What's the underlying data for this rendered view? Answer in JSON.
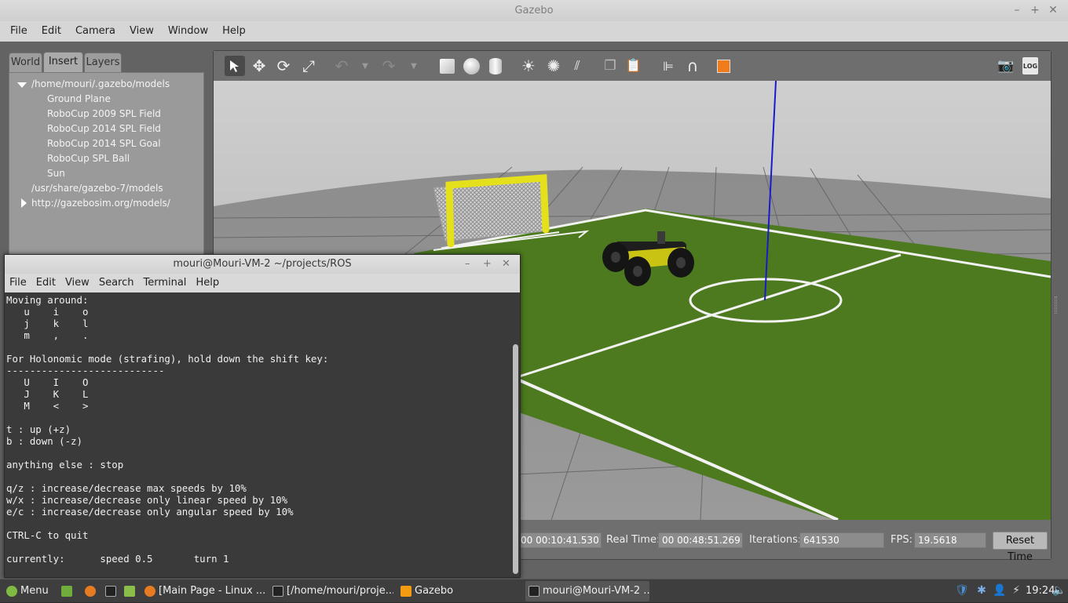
{
  "window": {
    "title": "Gazebo"
  },
  "menu": [
    "File",
    "Edit",
    "Camera",
    "View",
    "Window",
    "Help"
  ],
  "left_tabs": [
    "World",
    "Insert",
    "Layers"
  ],
  "insert_tree": {
    "root1": "/home/mouri/.gazebo/models",
    "models": [
      "Ground Plane",
      "RoboCup 2009 SPL Field",
      "RoboCup 2014 SPL Field",
      "RoboCup 2014 SPL Goal",
      "RoboCup SPL Ball",
      "Sun"
    ],
    "root2": "/usr/share/gazebo-7/models",
    "root3": "http://gazebosim.org/models/"
  },
  "status": {
    "sim_time": "00 00:10:41.530",
    "real_time_label": "Real Time:",
    "real_time": "00 00:48:51.269",
    "iterations_label": "Iterations:",
    "iterations": "641530",
    "fps_label": "FPS:",
    "fps": "19.5618",
    "reset_label": "Reset Time"
  },
  "toolbar": {
    "log_label": "LOG"
  },
  "terminal": {
    "title": "mouri@Mouri-VM-2 ~/projects/ROS",
    "menu": [
      "File",
      "Edit",
      "View",
      "Search",
      "Terminal",
      "Help"
    ],
    "text": "Moving around:\n   u    i    o\n   j    k    l\n   m    ,    .\n\nFor Holonomic mode (strafing), hold down the shift key:\n---------------------------\n   U    I    O\n   J    K    L\n   M    <    >\n\nt : up (+z)\nb : down (-z)\n\nanything else : stop\n\nq/z : increase/decrease max speeds by 10%\nw/x : increase/decrease only linear speed by 10%\ne/c : increase/decrease only angular speed by 10%\n\nCTRL-C to quit\n\ncurrently:      speed 0.5       turn 1"
  },
  "taskbar": {
    "menu_label": "Menu",
    "windows": [
      "[Main Page - Linux ...",
      "[/home/mouri/proje...",
      "Gazebo",
      "mouri@Mouri-VM-2 ..."
    ],
    "clock": "19:24"
  },
  "colors": {
    "grass": "#4d7a1e",
    "goal": "#e5e01c",
    "axis": "#1a1acc"
  }
}
